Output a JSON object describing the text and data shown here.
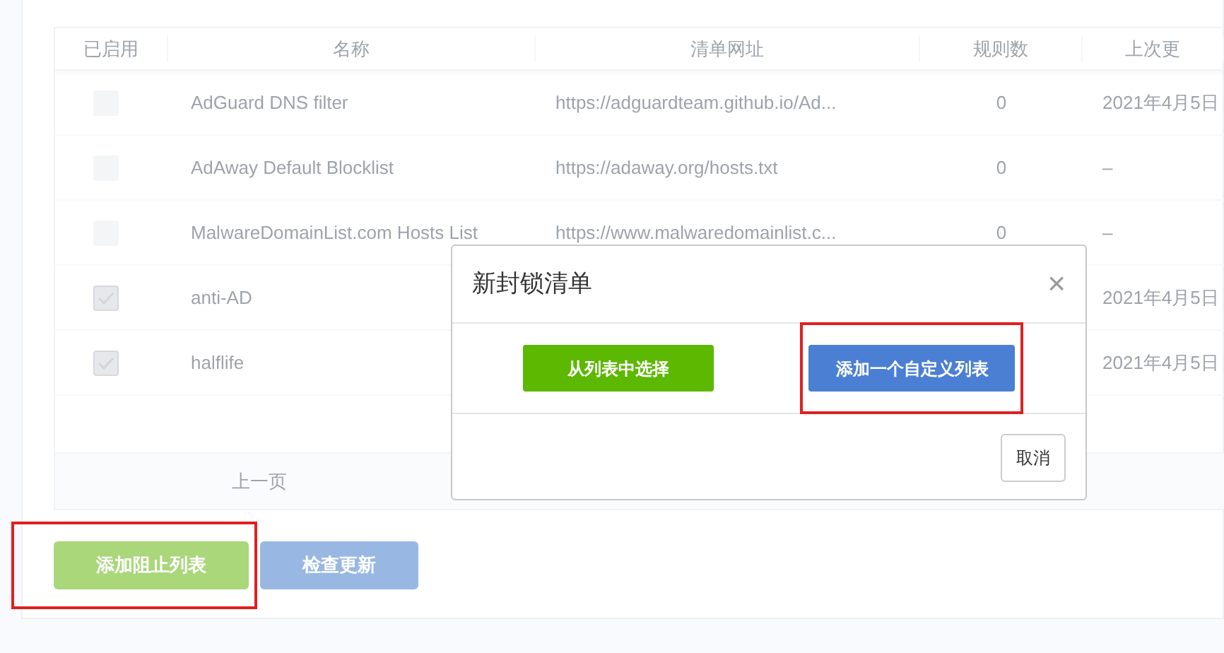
{
  "table": {
    "columns": [
      "已启用",
      "名称",
      "清单网址",
      "规则数",
      "上次更"
    ],
    "rows": [
      {
        "enabled": false,
        "name": "AdGuard DNS filter",
        "url": "https://adguardteam.github.io/Ad...",
        "rules": "0",
        "updated": "2021年4月5日"
      },
      {
        "enabled": false,
        "name": "AdAway Default Blocklist",
        "url": "https://adaway.org/hosts.txt",
        "rules": "0",
        "updated": "–"
      },
      {
        "enabled": false,
        "name": "MalwareDomainList.com Hosts List",
        "url": "https://www.malwaredomainlist.c...",
        "rules": "0",
        "updated": "–"
      },
      {
        "enabled": true,
        "name": "anti-AD",
        "updated": "2021年4月5日"
      },
      {
        "enabled": true,
        "name": "halflife",
        "updated": "2021年4月5日"
      }
    ]
  },
  "pagination": {
    "previous": "上一页"
  },
  "actions": [
    {
      "label": "添加阻止列表",
      "kind": "green",
      "highlighted": true
    },
    {
      "label": "检查更新",
      "kind": "blue",
      "highlighted": false
    }
  ],
  "dialog": {
    "title": "新封锁清单",
    "close": "×",
    "options": [
      {
        "label": "从列表中选择",
        "kind": "green",
        "highlighted": false
      },
      {
        "label": "添加一个自定义列表",
        "kind": "blue",
        "highlighted": true
      }
    ],
    "cancel": "取消"
  }
}
